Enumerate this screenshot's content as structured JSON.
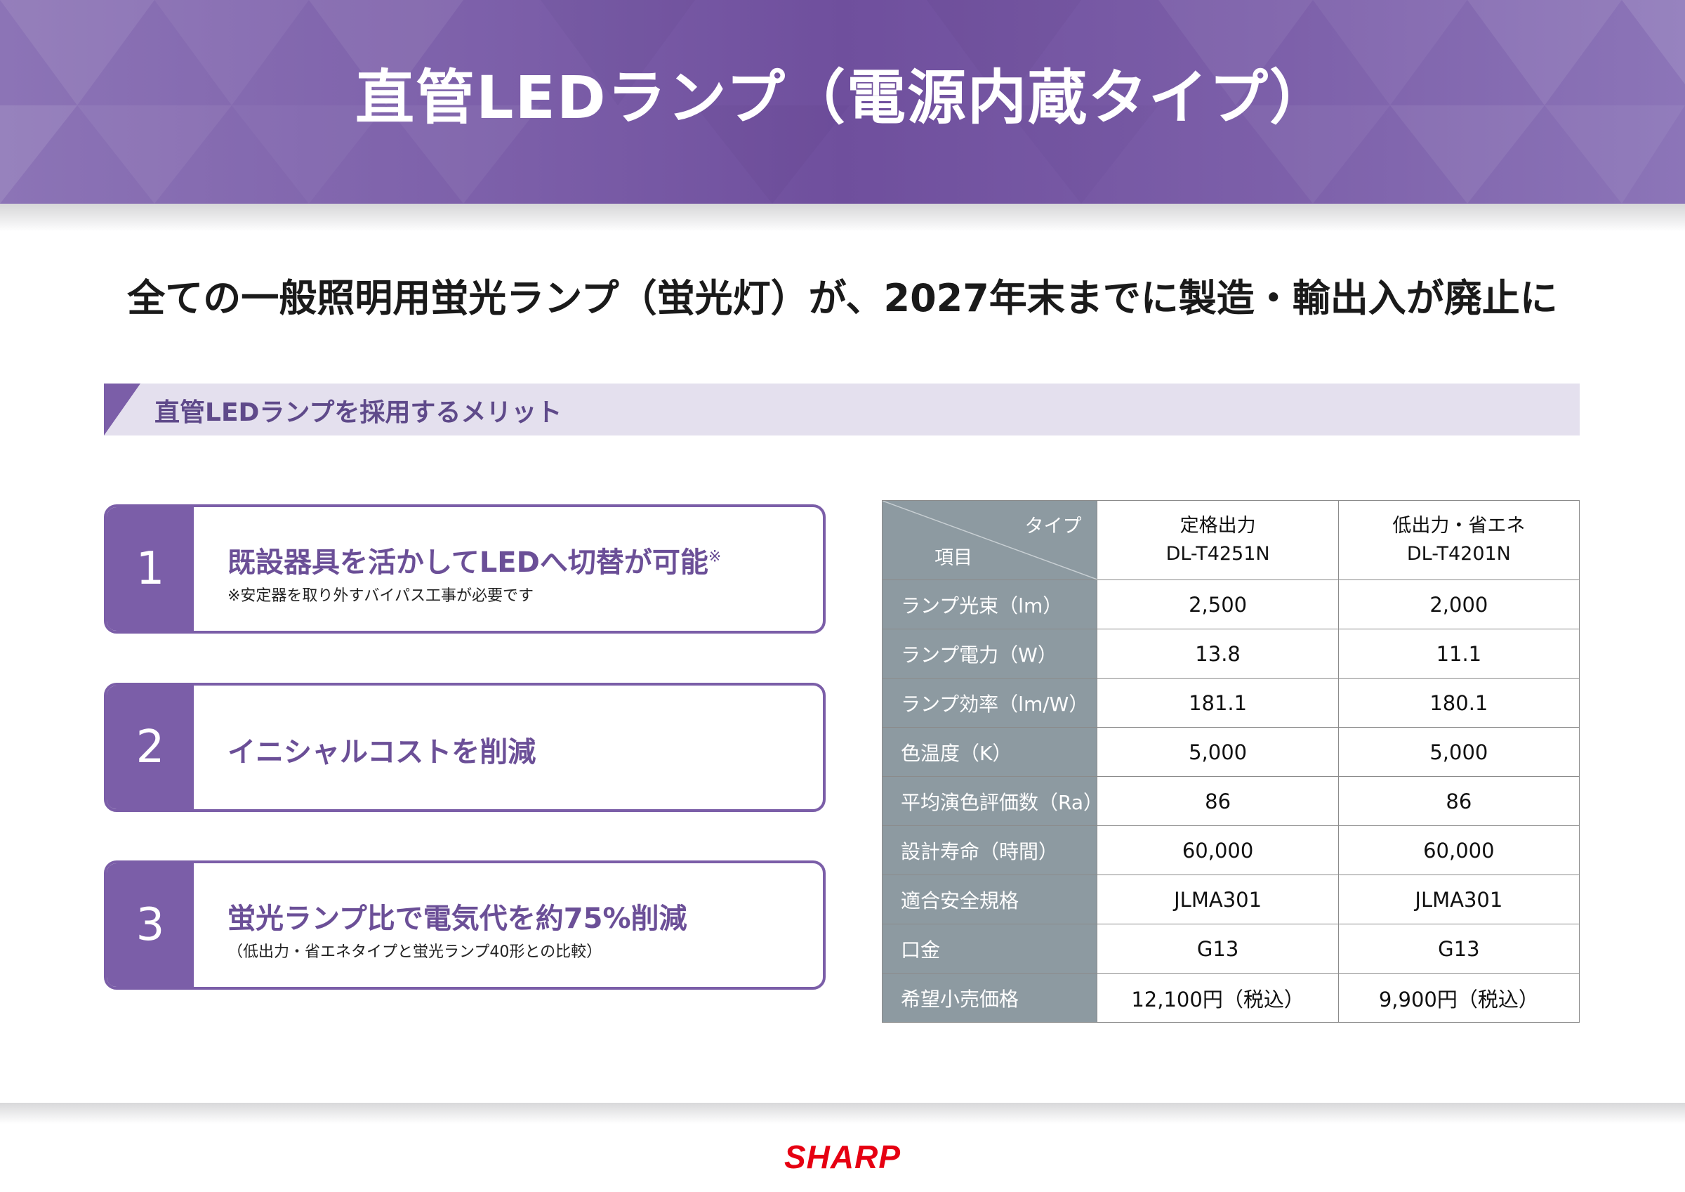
{
  "header": {
    "title": "直管LEDランプ（電源内蔵タイプ）",
    "bg_color": "#7b5ea8"
  },
  "headline": "全ての一般照明用蛍光ランプ（蛍光灯）が、2027年末までに製造・輸出入が廃止に",
  "section": {
    "title": "直管LEDランプを採用するメリット"
  },
  "merits": [
    {
      "num": "1",
      "text": "既設器具を活かしてLEDへ切替が可能",
      "mark": "※",
      "note": "※安定器を取り外すバイパス工事が必要です"
    },
    {
      "num": "2",
      "text": "イニシャルコストを削減",
      "note": ""
    },
    {
      "num": "3",
      "text": "蛍光ランプ比で電気代を約75%削減",
      "note": "（低出力・省エネタイプと蛍光ランプ40形との比較）"
    }
  ],
  "table": {
    "corner_type": "タイプ",
    "corner_item": "項目",
    "columns": [
      {
        "name": "定格出力",
        "model": "DL-T4251N"
      },
      {
        "name": "低出力・省エネ",
        "model": "DL-T4201N"
      }
    ],
    "rows": [
      {
        "label": "ランプ光束（lm）",
        "values": [
          "2,500",
          "2,000"
        ]
      },
      {
        "label": "ランプ電力（W）",
        "values": [
          "13.8",
          "11.1"
        ]
      },
      {
        "label": "ランプ効率（lm/W）",
        "values": [
          "181.1",
          "180.1"
        ]
      },
      {
        "label": "色温度（K）",
        "values": [
          "5,000",
          "5,000"
        ]
      },
      {
        "label": "平均演色評価数（Ra）",
        "values": [
          "86",
          "86"
        ]
      },
      {
        "label": "設計寿命（時間）",
        "values": [
          "60,000",
          "60,000"
        ]
      },
      {
        "label": "適合安全規格",
        "values": [
          "JLMA301",
          "JLMA301"
        ]
      },
      {
        "label": "口金",
        "values": [
          "G13",
          "G13"
        ]
      },
      {
        "label": "希望小売価格",
        "values": [
          "12,100円（税込）",
          "9,900円（税込）"
        ]
      }
    ]
  },
  "footer": {
    "logo": "SHARP",
    "logo_color": "#e60012"
  }
}
